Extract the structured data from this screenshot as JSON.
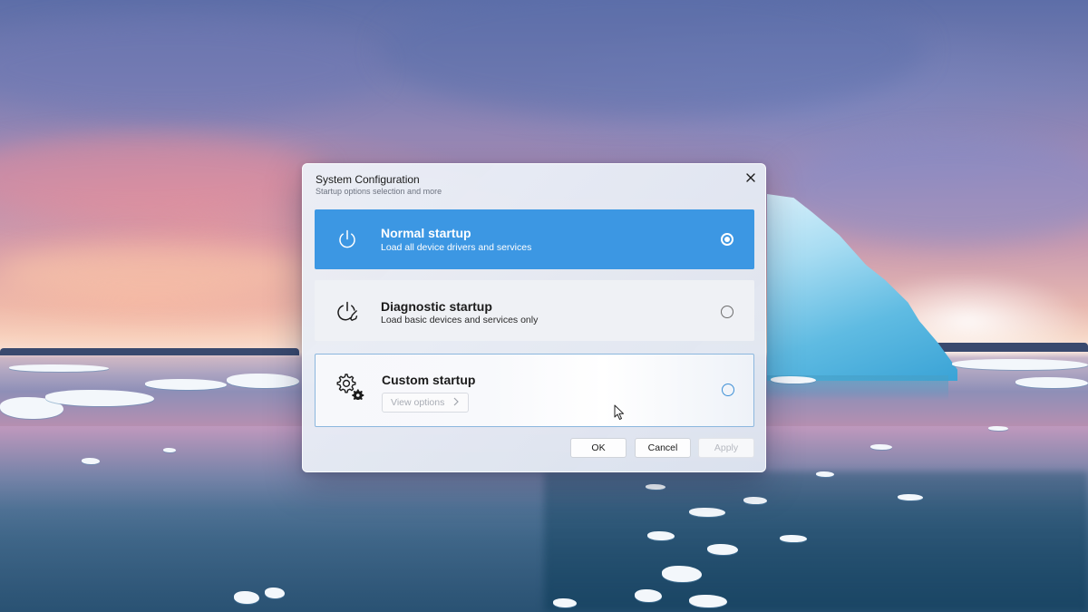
{
  "desktop": {
    "wallpaper": "sunset-icebergs"
  },
  "dialog": {
    "title": "System Configuration",
    "subtitle": "Startup options selection and more",
    "close_icon": "close-icon",
    "options": [
      {
        "title": "Normal startup",
        "description": "Load all device drivers and services",
        "icon": "power-icon",
        "selected": true
      },
      {
        "title": "Diagnostic startup",
        "description": "Load basic devices and services only",
        "icon": "power-wrench-icon",
        "selected": false
      },
      {
        "title": "Custom startup",
        "icon": "gears-icon",
        "view_options_label": "View options",
        "view_options_icon": "chevron-right-icon",
        "selected": false
      }
    ],
    "buttons": {
      "ok": "OK",
      "cancel": "Cancel",
      "apply": "Apply",
      "apply_enabled": false
    }
  },
  "colors": {
    "accent": "#3c97e3",
    "selected_card_text": "#ffffff",
    "disabled_text": "#b6b9c0"
  }
}
